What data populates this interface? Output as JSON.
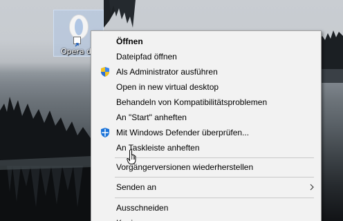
{
  "desktop": {
    "icon_label": "Opera d"
  },
  "context_menu": {
    "items": [
      {
        "label": "Öffnen",
        "bold": true
      },
      {
        "label": "Dateipfad öffnen"
      },
      {
        "label": "Als Administrator ausführen",
        "icon": "uac-shield-icon"
      },
      {
        "label": "Open in new virtual desktop"
      },
      {
        "label": "Behandeln von Kompatibilitätsproblemen"
      },
      {
        "label": "An \"Start\" anheften"
      },
      {
        "label": "Mit Windows Defender überprüfen...",
        "icon": "windows-defender-icon"
      },
      {
        "label": "An Taskleiste anheften",
        "hovered": true
      },
      {
        "label": "Vorgängerversionen wiederherstellen"
      },
      {
        "label": "Senden an",
        "has_submenu": true
      },
      {
        "label": "Ausschneiden"
      },
      {
        "label": "Kopieren"
      }
    ]
  },
  "colors": {
    "menu_background": "#f2f2f2",
    "menu_border": "#a0a0a0",
    "separator": "#c8c8c8",
    "selection_highlight": "#b0c6e4",
    "opera_red": "#d62d2d"
  }
}
